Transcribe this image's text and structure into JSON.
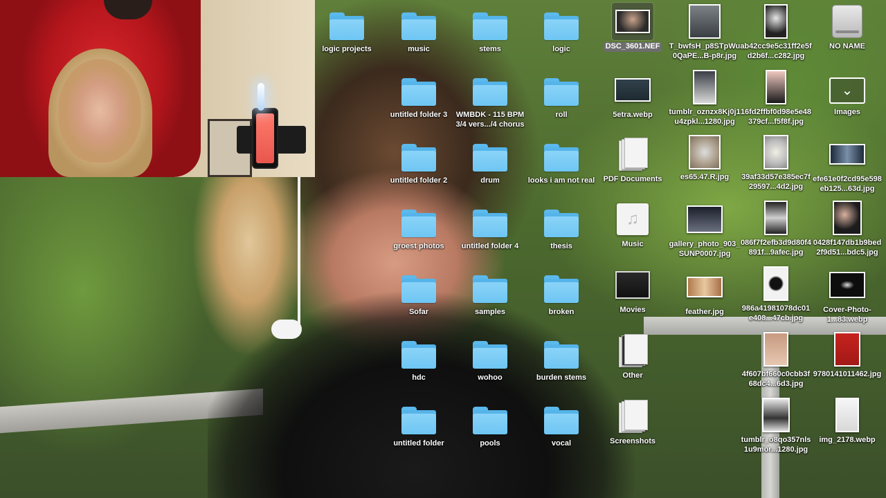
{
  "desktop": {
    "folders": [
      {
        "label": "logic projects"
      },
      {
        "label": "music"
      },
      {
        "label": "stems"
      },
      {
        "label": "logic"
      },
      {
        "label": "untitled folder 3"
      },
      {
        "label": "WMBDK - 115 BPM 3/4 vers.../4 chorus"
      },
      {
        "label": "roll"
      },
      {
        "label": "untitled folder 2"
      },
      {
        "label": "drum"
      },
      {
        "label": "looks i am not real"
      },
      {
        "label": "groest photos"
      },
      {
        "label": "untitled folder 4"
      },
      {
        "label": "thesis"
      },
      {
        "label": "Sofar"
      },
      {
        "label": "samples"
      },
      {
        "label": "broken"
      },
      {
        "label": "hdc"
      },
      {
        "label": "wohoo"
      },
      {
        "label": "burden stems"
      },
      {
        "label": "untitled folder"
      },
      {
        "label": "pools"
      },
      {
        "label": "vocal"
      }
    ],
    "col5": [
      {
        "label": "DSC_3601.NEF",
        "selected": true
      },
      {
        "label": "5etra.webp"
      },
      {
        "label": "PDF Documents"
      },
      {
        "label": "Music"
      },
      {
        "label": "Movies"
      },
      {
        "label": "Other"
      },
      {
        "label": "Screenshots"
      }
    ],
    "col6": [
      {
        "label": "T_bwfsH_p8STpWu0QaPE...B-p8r.jpg"
      },
      {
        "label": "tumblr_oznzx8Kj0j1u4zpkl...1280.jpg"
      },
      {
        "label": "es65.47.R.jpg"
      },
      {
        "label": "gallery_photo_903_SUNP0007.jpg"
      },
      {
        "label": "feather.jpg"
      }
    ],
    "col7": [
      {
        "label": "ab42cc9e5c31ff2e5fd2b6f...c282.jpg"
      },
      {
        "label": "16fd2ffbf0d98e5e48379cf...f5f8f.jpg"
      },
      {
        "label": "39af33d57e385ec7f29597...4d2.jpg"
      },
      {
        "label": "086f7f2efb3d9d80f4891f...9afec.jpg"
      },
      {
        "label": "986a41981078dc01e408...47cb.jpg"
      },
      {
        "label": "4f607bf660c0cbb3f68dc4...6d3.jpg"
      },
      {
        "label": "tumblr_o8qo357nls1u9mor...1280.jpg"
      }
    ],
    "col8": [
      {
        "label": "NO NAME"
      },
      {
        "label": "Images"
      },
      {
        "label": "efe61e0f2cd95e598eb125...63d.jpg"
      },
      {
        "label": "0428f147db1b9bed2f9d51...bdc5.jpg"
      },
      {
        "label": "Cover-Photo-1...83.webp"
      },
      {
        "label": "9780141011462.jpg"
      },
      {
        "label": "img_2178.webp"
      }
    ]
  },
  "colors": {
    "folder_blue": "#6ec6f3",
    "selection_gray": "#6d6d6d"
  },
  "icons": {
    "folder": "folder-icon",
    "drive": "external-drive-icon",
    "images": "chevron-down-icon",
    "music": "music-note-icon"
  }
}
